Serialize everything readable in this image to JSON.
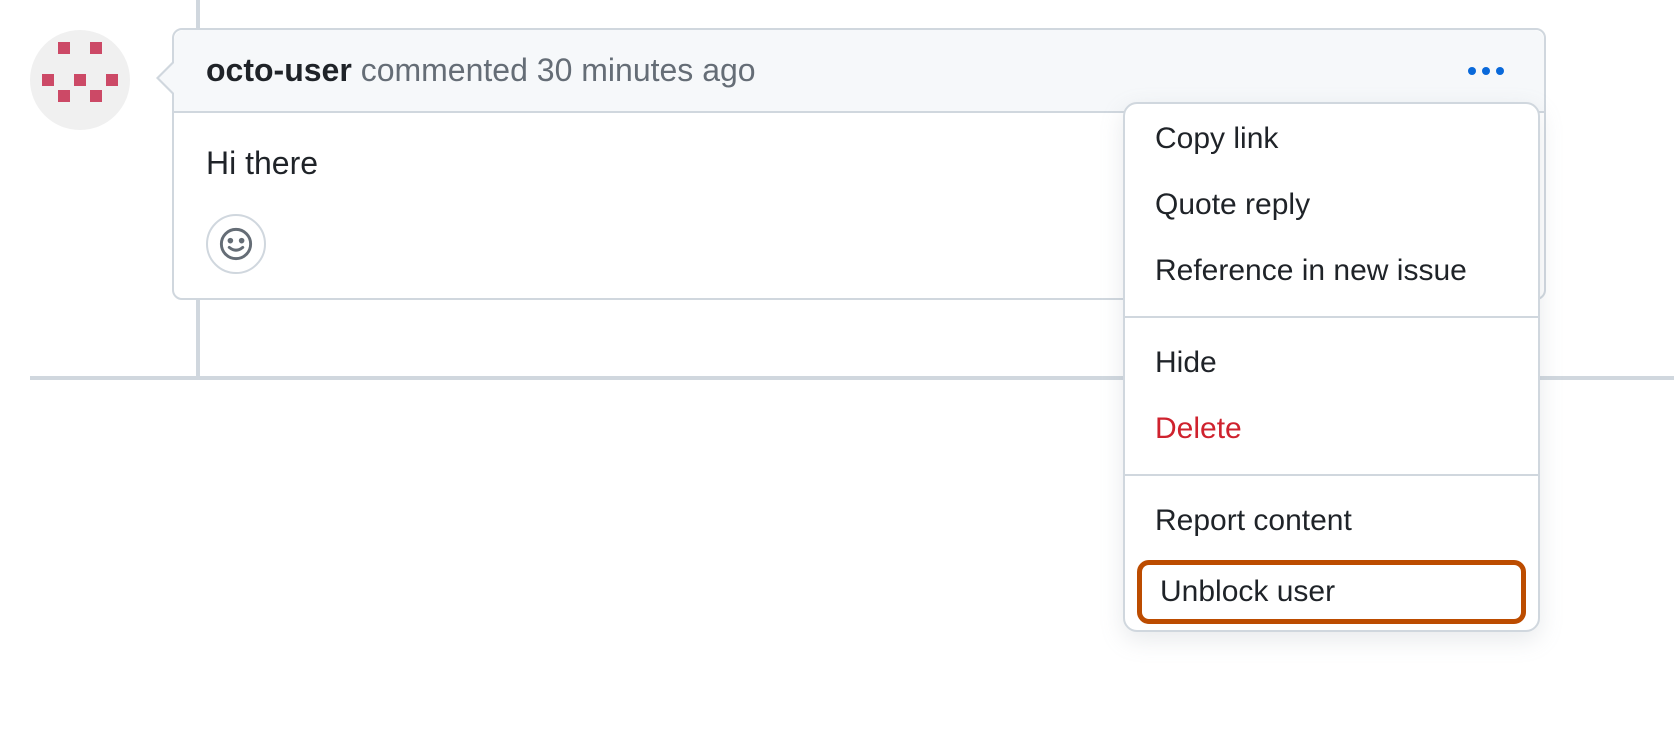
{
  "comment": {
    "username": "octo-user",
    "action_text": "commented",
    "timestamp": "30 minutes ago",
    "body": "Hi there"
  },
  "menu": {
    "copy_link": "Copy link",
    "quote_reply": "Quote reply",
    "reference_issue": "Reference in new issue",
    "hide": "Hide",
    "delete": "Delete",
    "report_content": "Report content",
    "unblock_user": "Unblock user"
  }
}
